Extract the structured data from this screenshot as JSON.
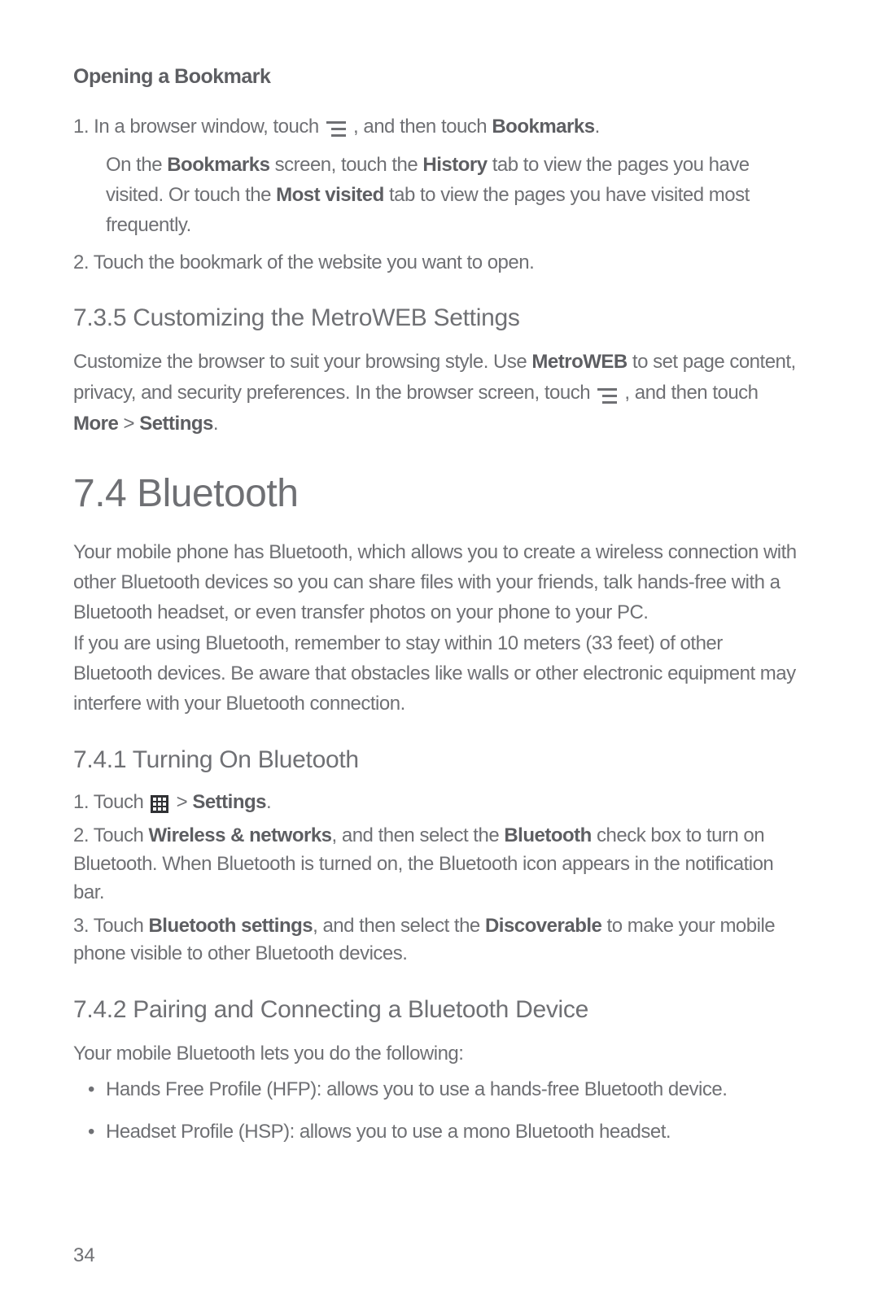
{
  "section_opening_bookmark": {
    "title": "Opening a Bookmark",
    "step1_a": "1. In a browser window, touch ",
    "step1_b": " , and then touch ",
    "step1_bold": "Bookmarks",
    "step1_c": ".",
    "note_a": "On the ",
    "note_bold1": "Bookmarks",
    "note_b": " screen, touch the ",
    "note_bold2": "History",
    "note_c": " tab to view the pages you have visited. Or touch the ",
    "note_bold3": "Most visited",
    "note_d": " tab to view the pages you have visited most frequently.",
    "step2": "2. Touch the bookmark of the website you want to open."
  },
  "section_735": {
    "title": "7.3.5  Customizing the MetroWEB Settings",
    "p1_a": "Customize the browser to suit your browsing style. Use ",
    "p1_bold1": "MetroWEB",
    "p1_b": " to set page content, privacy, and security preferences. In the browser screen, touch ",
    "p1_c": " , and then touch ",
    "p1_bold2": "More",
    "p1_d": " > ",
    "p1_bold3": "Settings",
    "p1_e": "."
  },
  "section_74": {
    "title": "7.4  Bluetooth",
    "p1": "Your mobile phone has Bluetooth, which allows you to create a wireless connection with other Bluetooth devices so you can share files with your friends, talk hands-free with a Bluetooth headset, or even transfer photos on your phone to your PC.",
    "p2": "If you are using Bluetooth, remember to stay within 10 meters (33 feet) of other Bluetooth devices. Be aware that obstacles like walls or other electronic equipment may interfere with your Bluetooth connection."
  },
  "section_741": {
    "title": "7.4.1  Turning On Bluetooth",
    "step1_a": "1. Touch ",
    "step1_b": " > ",
    "step1_bold": "Settings",
    "step1_c": ".",
    "step2_a": "2. Touch ",
    "step2_bold1": "Wireless & networks",
    "step2_b": ", and then select the ",
    "step2_bold2": "Bluetooth",
    "step2_c": " check box to turn on Bluetooth. When Bluetooth is turned on, the Bluetooth icon appears in the notification bar.",
    "step3_a": "3. Touch ",
    "step3_bold1": "Bluetooth settings",
    "step3_b": ", and then select the ",
    "step3_bold2": "Discoverable",
    "step3_c": " to make your mobile phone visible to other Bluetooth devices."
  },
  "section_742": {
    "title": "7.4.2  Pairing and Connecting a Bluetooth Device",
    "p1": "Your mobile Bluetooth lets you do the following:",
    "li1": "Hands Free Profile (HFP): allows you to use a hands-free Bluetooth device.",
    "li2": "Headset Profile (HSP): allows you to use a mono Bluetooth headset."
  },
  "page_number": "34"
}
